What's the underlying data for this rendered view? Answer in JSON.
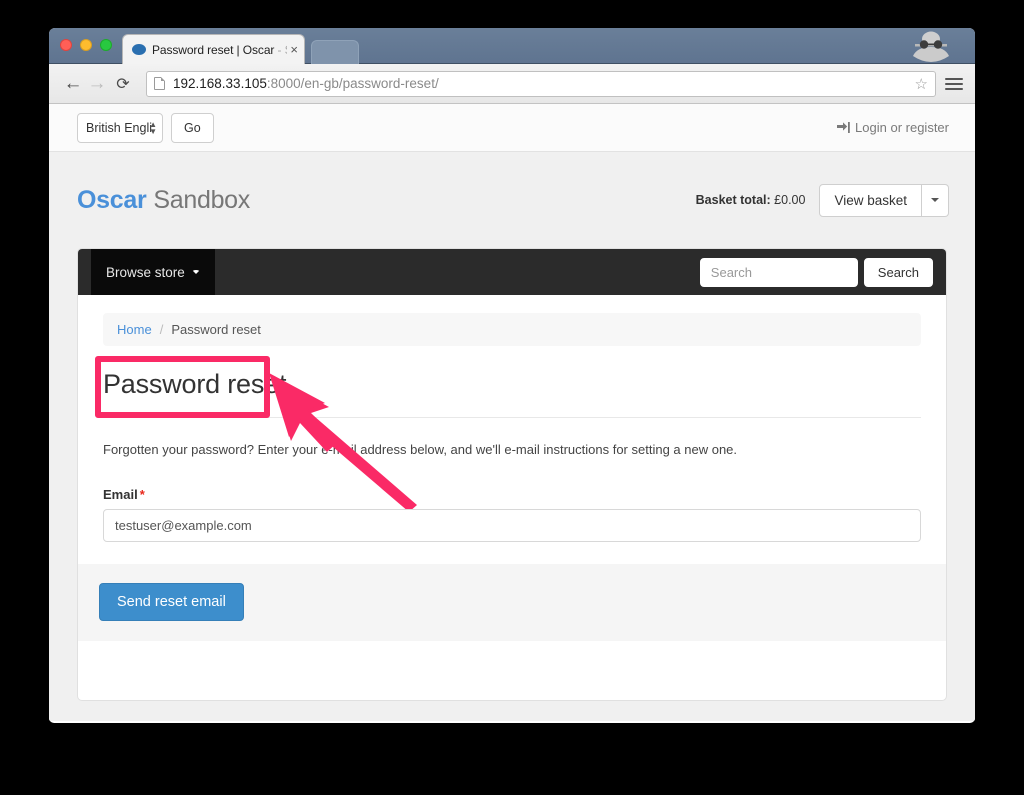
{
  "browser": {
    "tab": {
      "title_main": "Password reset | Oscar",
      "title_dim": " - S",
      "close_label": "×",
      "favicon_name": "oscar-favicon"
    },
    "toolbar": {
      "back_glyph": "←",
      "forward_glyph": "→",
      "reload_glyph": "⟳",
      "url_host": "192.168.33.105",
      "url_rest": ":8000/en-gb/password-reset/",
      "star_glyph": "☆"
    },
    "incognito_icon_name": "incognito-spy-icon"
  },
  "util_bar": {
    "language_selected": "British Engli",
    "go_label": "Go",
    "login_label": "Login or register"
  },
  "brand": {
    "name": "Oscar",
    "suffix": "Sandbox"
  },
  "basket": {
    "total_label": "Basket total:",
    "total_value": "£0.00",
    "view_label": "View basket"
  },
  "navbar": {
    "browse_label": "Browse store",
    "search_placeholder": "Search",
    "search_button_label": "Search"
  },
  "breadcrumb": {
    "home": "Home",
    "separator": "/",
    "current": "Password reset"
  },
  "main": {
    "page_title": "Password reset",
    "intro": "Forgotten your password? Enter your e-mail address below, and we'll e-mail instructions for setting a new one.",
    "email_label": "Email",
    "required_marker": "*",
    "email_value": "testuser@example.com",
    "submit_label": "Send reset email"
  },
  "annotation": {
    "highlight_color": "#fa2a66",
    "target": "send-reset-email-button"
  },
  "colors": {
    "brand_blue": "#4a90d9",
    "button_blue": "#3d8ecc",
    "navbar_dark": "#2b2b2b",
    "required_red": "#e8271b",
    "annotation_pink": "#fa2a66"
  }
}
